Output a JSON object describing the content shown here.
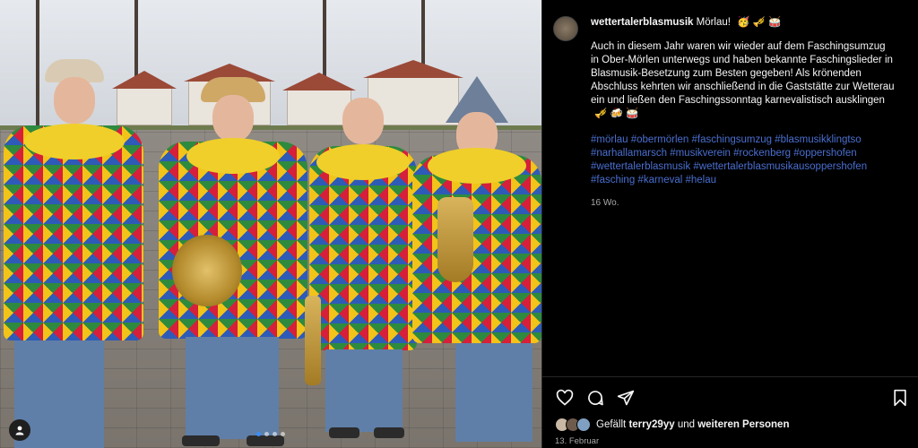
{
  "post": {
    "username": "wettertalerblasmusik",
    "title": "Mörlau!",
    "title_emojis": "🥳 🎺 🥁",
    "body": "Auch in diesem Jahr waren wir wieder auf dem Faschingsumzug in Ober-Mörlen unterwegs und haben bekannte Faschingslieder in Blasmusik-Besetzung zum Besten gegeben! Als krönenden Abschluss kehrten wir anschließend in die Gaststätte zur Wetterau ein und ließen den Faschingssonntag karnevalistisch ausklingen",
    "body_emojis": "🎺 🍻 🥁",
    "hashtags": "#mörlau #obermörlen #faschingsumzug #blasmusikklingtso #narhallamarsch #musikverein #rockenberg #oppershofen #wettertalerblasmusik #wettertalerblasmusikausoppershofen #fasching #karneval #helau",
    "age": "16 Wo.",
    "likes_prefix": "Gefällt",
    "likes_user": "terry29yy",
    "likes_middle": "und",
    "likes_others": "weiteren Personen",
    "date": "13. Februar"
  },
  "carousel": {
    "count": 4,
    "active_index": 0
  },
  "icons": {
    "like": "heart-icon",
    "comment": "comment-icon",
    "share": "share-icon",
    "save": "bookmark-icon",
    "tags": "user-tag-icon"
  },
  "colors": {
    "hashtag": "#4a6fd0",
    "muted": "#a8a8a8",
    "background": "#000000"
  }
}
